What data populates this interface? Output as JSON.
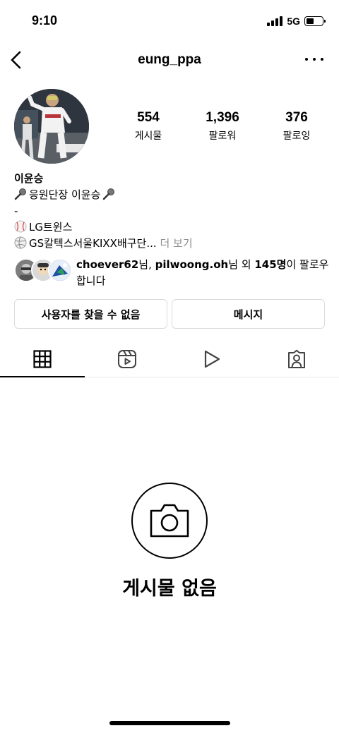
{
  "status_bar": {
    "time": "9:10",
    "network": "5G"
  },
  "nav": {
    "username": "eung_ppa"
  },
  "stats": [
    {
      "value": "554",
      "label": "게시물"
    },
    {
      "value": "1,396",
      "label": "팔로워"
    },
    {
      "value": "376",
      "label": "팔로잉"
    }
  ],
  "bio": {
    "name": "이윤승",
    "line1": "응원단장 이윤승",
    "line2": "-",
    "line3": "LG트윈스",
    "line4": "GS칼텍스서울KIXX배구단...",
    "more": "더 보기"
  },
  "mutuals": {
    "user1": "choever62",
    "sep1": "님, ",
    "user2": "pilwoong.oh",
    "sep2": "님 외 ",
    "count": "145명",
    "tail": "이 팔로우합니다"
  },
  "actions": {
    "unavailable": "사용자를 찾을 수 없음",
    "message": "메시지"
  },
  "empty": {
    "title": "게시물 없음"
  }
}
